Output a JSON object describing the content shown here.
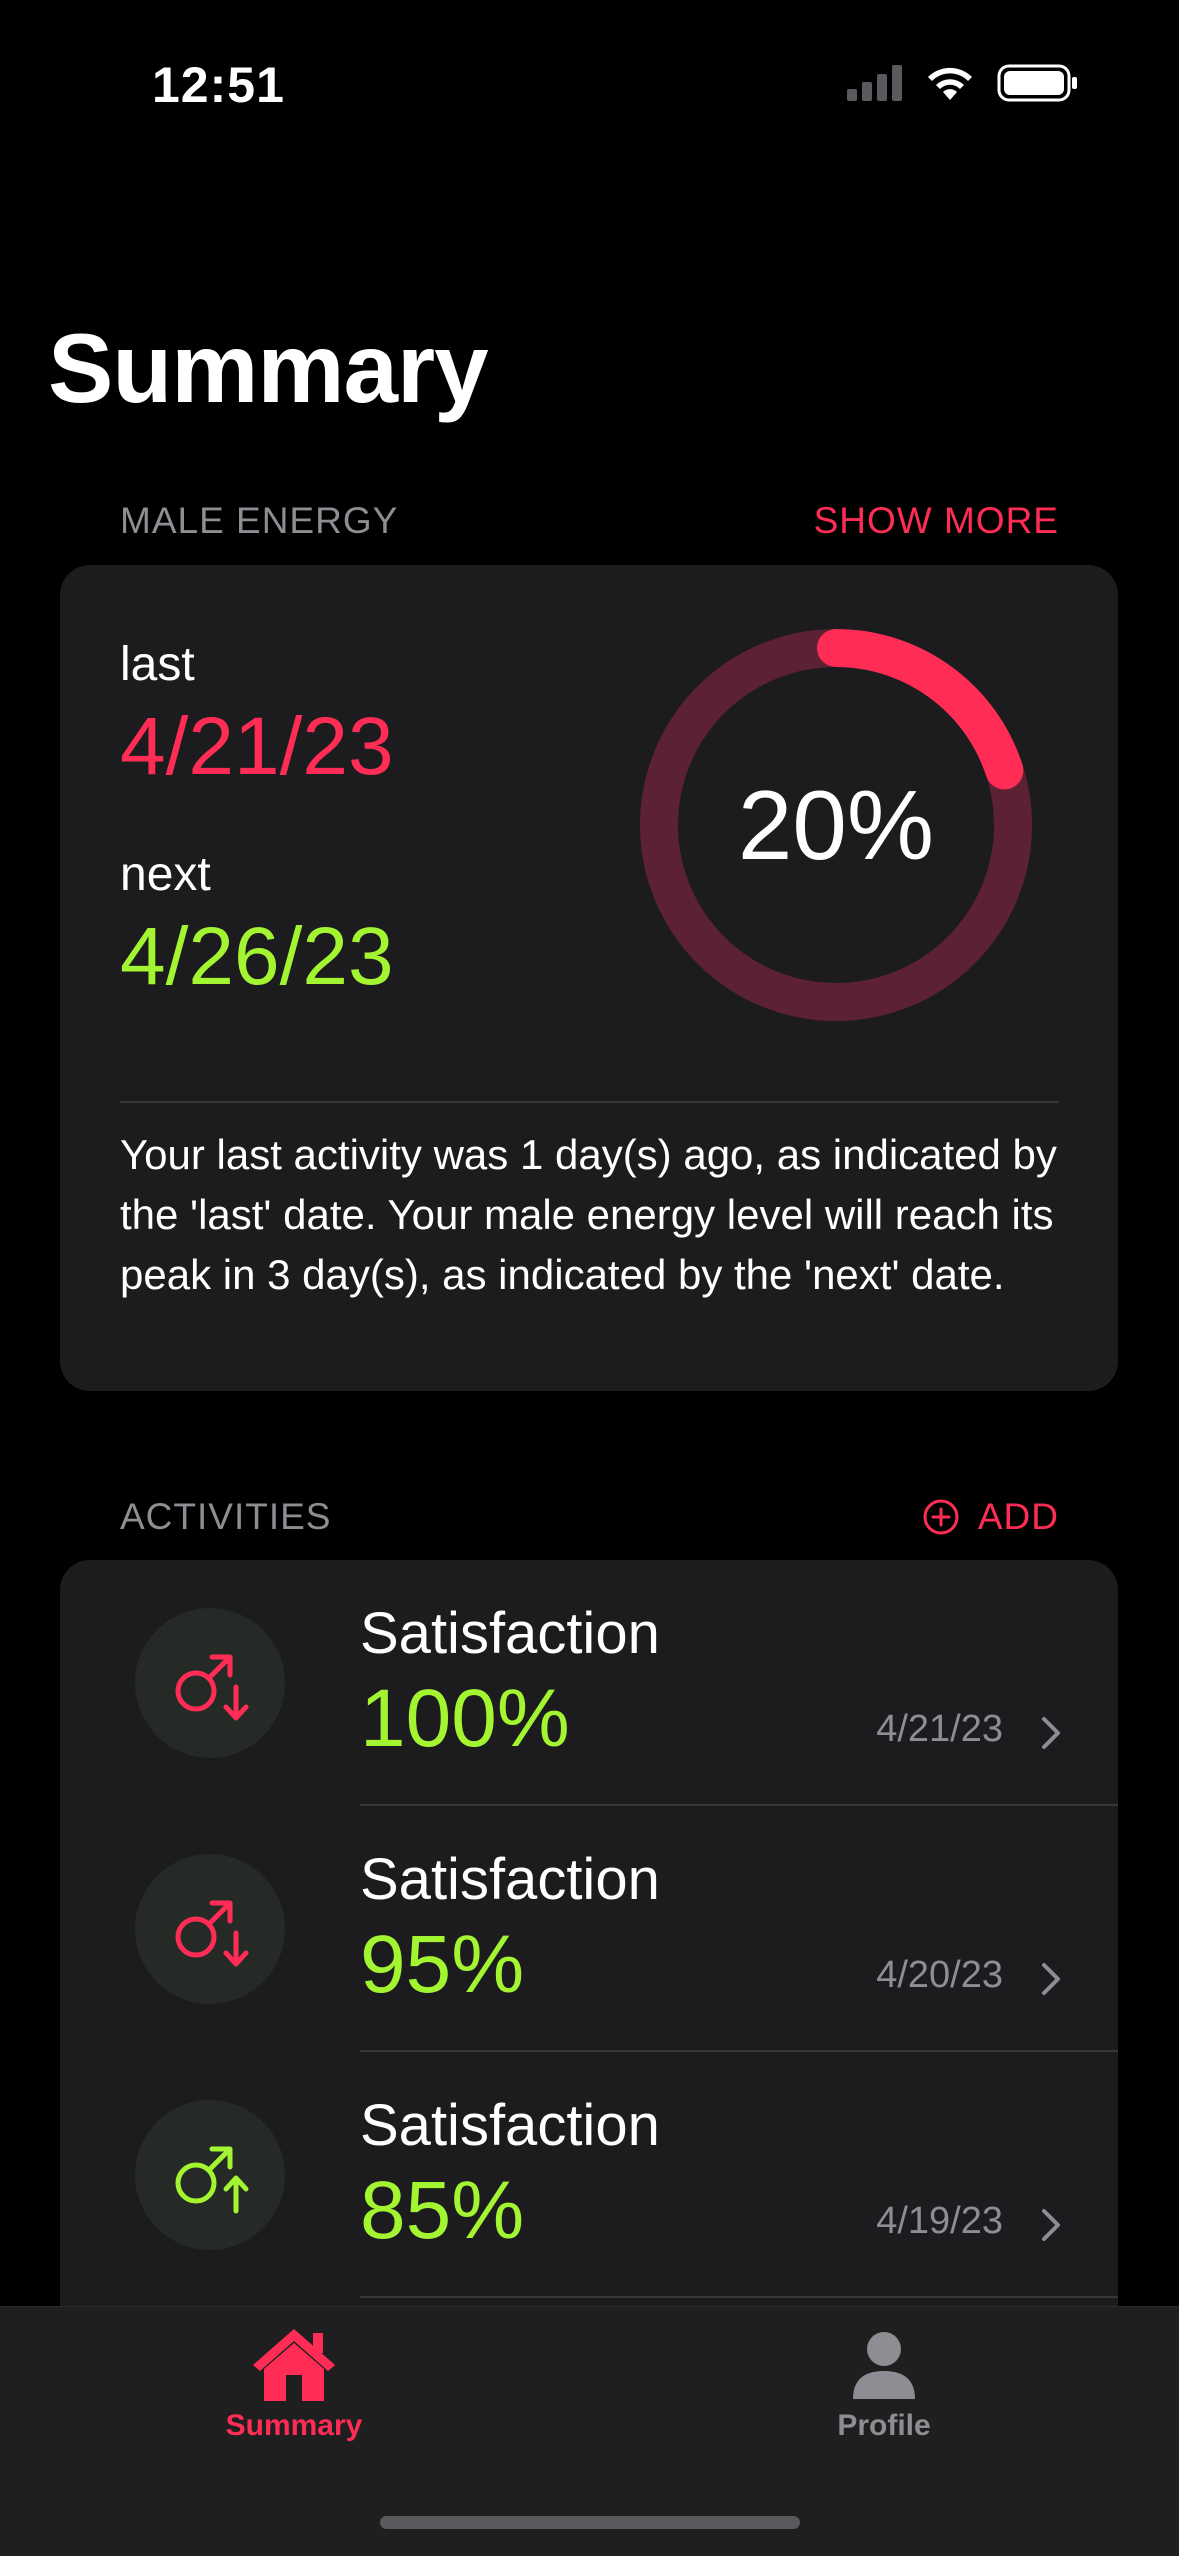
{
  "status_bar": {
    "time": "12:51"
  },
  "page": {
    "title": "Summary"
  },
  "male_energy": {
    "section_label": "MALE ENERGY",
    "show_more": "SHOW MORE",
    "last_label": "last",
    "last_date": "4/21/23",
    "next_label": "next",
    "next_date": "4/26/23",
    "percent_text": "20%",
    "progress_fraction": 0.2,
    "description": "Your last activity was 1 day(s) ago, as indicated by the 'last' date. Your male energy level will reach its peak in 3 day(s), as indicated by the 'next' date."
  },
  "activities": {
    "section_label": "ACTIVITIES",
    "add_label": "ADD",
    "items": [
      {
        "title": "Satisfaction",
        "value": "100%",
        "date": "4/21/23",
        "icon": "male-down-arrow-icon",
        "icon_color": "#ff2d55"
      },
      {
        "title": "Satisfaction",
        "value": "95%",
        "date": "4/20/23",
        "icon": "male-down-arrow-icon",
        "icon_color": "#ff2d55"
      },
      {
        "title": "Satisfaction",
        "value": "85%",
        "date": "4/19/23",
        "icon": "male-up-arrow-icon",
        "icon_color": "#a4f531"
      }
    ]
  },
  "tab_bar": {
    "summary_label": "Summary",
    "profile_label": "Profile",
    "active": "summary"
  },
  "colors": {
    "accent_pink": "#ff2d55",
    "accent_green": "#a4f531",
    "card_background": "#1c1c1e",
    "secondary_text": "#8d8d93"
  }
}
